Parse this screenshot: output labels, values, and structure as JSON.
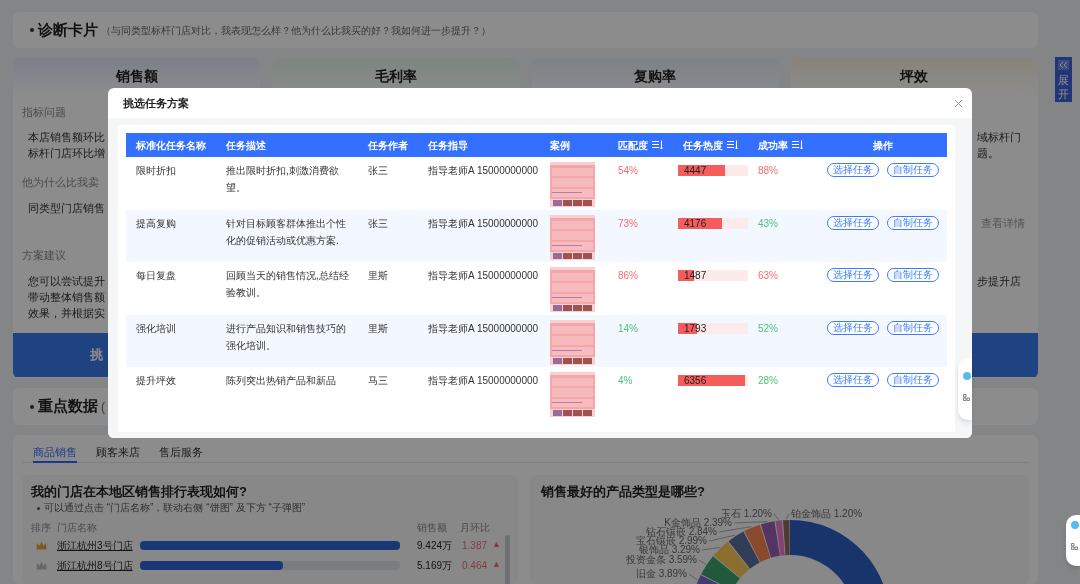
{
  "expand_tab": {
    "label": "展开"
  },
  "diagnosis_header": {
    "title": "诊断卡片",
    "subtitle": "（与同类型标杆门店对比，我表现怎么样？他为什么比我买的好？我如何进一步提升？）"
  },
  "metric_cards": [
    {
      "title": "销售额",
      "sections": [
        {
          "heading": "指标问题",
          "lines": [
            "本店销售额环比",
            "标杆门店环比增"
          ]
        },
        {
          "heading": "他为什么比我卖",
          "lines": [
            "同类型门店销售"
          ]
        },
        {
          "heading": "方案建议",
          "lines": [
            "您可以尝试提升",
            "带动整体销售额",
            "效果，并根据实"
          ]
        }
      ],
      "button": true,
      "button_label": "挑"
    },
    {
      "title": "毛利率"
    },
    {
      "title": "复购率"
    },
    {
      "title": "坪效",
      "sections": [
        {
          "lines": [
            "域标杆门",
            "题。"
          ]
        },
        {
          "link": "查看详情"
        },
        {
          "lines": [
            "步提升店"
          ]
        }
      ],
      "button": true
    }
  ],
  "key_data_header": {
    "title": "重点数据",
    "subtitle": "("
  },
  "tabs": [
    {
      "label": "商品销售",
      "selected": true
    },
    {
      "label": "顾客来店",
      "selected": false
    },
    {
      "label": "售后服务",
      "selected": false
    }
  ],
  "ranking": {
    "title": "我的门店在本地区销售排行表现如何?",
    "note": "可以通过点击 “门店名称”，联动右侧 “饼图” 及下方 “子弹图”",
    "columns": [
      "排序",
      "门店名称",
      "销售额",
      "月环比"
    ],
    "rows": [
      {
        "kind": "gold",
        "store": "浙江杭州3号门店",
        "level": 1.0,
        "sales": "9.424万",
        "change": "1.387",
        "trend": "▲"
      },
      {
        "kind": "silver",
        "store": "浙江杭州8号门店",
        "level": 0.55,
        "sales": "5.169万",
        "change": "0.464",
        "trend": "▲"
      }
    ]
  },
  "product_chart": {
    "title": "销售最好的产品类型是哪些?",
    "slice_labels": [
      {
        "text": "玉石 1.20%"
      },
      {
        "text": "铂金饰品 1.20%"
      },
      {
        "text": "K金饰品 2.39%"
      },
      {
        "text": "钻石镶嵌 2.84%"
      },
      {
        "text": "宝石镶嵌 2.99%"
      },
      {
        "text": "银饰品 3.29%"
      },
      {
        "text": "投资金条 3.59%"
      },
      {
        "text": "旧金 3.89%"
      }
    ]
  },
  "modal": {
    "title": "挑选任务方案",
    "columns": [
      {
        "label": "标准化任务名称",
        "sortable": false
      },
      {
        "label": "任务描述",
        "sortable": false
      },
      {
        "label": "任务作者",
        "sortable": false
      },
      {
        "label": "任务指导",
        "sortable": false
      },
      {
        "label": "案例",
        "sortable": false
      },
      {
        "label": "匹配度",
        "sortable": true
      },
      {
        "label": "任务热度",
        "sortable": true
      },
      {
        "label": "成功率",
        "sortable": true
      },
      {
        "label": "操作",
        "sortable": false
      }
    ],
    "rows": [
      {
        "name": "限时折扣",
        "description": "推出限时折扣,刺激消费欲望。",
        "author": "张三",
        "guide": "指导老师A 15000000000",
        "case": {
          "kind": "picture"
        },
        "match": {
          "text": "54%",
          "high": true
        },
        "heat": {
          "text": "4447",
          "level": 0.67
        },
        "success": {
          "text": "88%",
          "high": true
        },
        "actions": [
          "选择任务",
          "自制任务"
        ]
      },
      {
        "name": "提高复购",
        "description": "针对目标顾客群体推出个性化的促销活动或优惠方案.",
        "author": "张三",
        "guide": "指导老师A 15000000000",
        "case": {
          "kind": "picture"
        },
        "match": {
          "text": "73%",
          "high": true
        },
        "heat": {
          "text": "4176",
          "level": 0.63
        },
        "success": {
          "text": "43%",
          "high": false
        },
        "actions": [
          "选择任务",
          "自制任务"
        ]
      },
      {
        "name": "每日复盘",
        "description": "回顾当天的销售情况,总结经验教训。",
        "author": "里斯",
        "guide": "指导老师A 15000000000",
        "case": {
          "kind": "picture"
        },
        "match": {
          "text": "86%",
          "high": true
        },
        "heat": {
          "text": "1487",
          "level": 0.23
        },
        "success": {
          "text": "63%",
          "high": true
        },
        "actions": [
          "选择任务",
          "自制任务"
        ]
      },
      {
        "name": "强化培训",
        "description": "进行产品知识和销售技巧的强化培训。",
        "author": "里斯",
        "guide": "指导老师A 15000000000",
        "case": {
          "kind": "picture"
        },
        "match": {
          "text": "14%",
          "high": false
        },
        "heat": {
          "text": "1793",
          "level": 0.27
        },
        "success": {
          "text": "52%",
          "high": false
        },
        "actions": [
          "选择任务",
          "自制任务"
        ]
      },
      {
        "name": "提升坪效",
        "description": "陈列突出热销产品和新品",
        "author": "马三",
        "guide": "指导老师A 15000000000",
        "case": {
          "kind": "picture"
        },
        "match": {
          "text": "4%",
          "high": false
        },
        "heat": {
          "text": "6356",
          "level": 0.96
        },
        "success": {
          "text": "28%",
          "high": false
        },
        "actions": [
          "选择任务",
          "自制任务"
        ]
      }
    ]
  }
}
